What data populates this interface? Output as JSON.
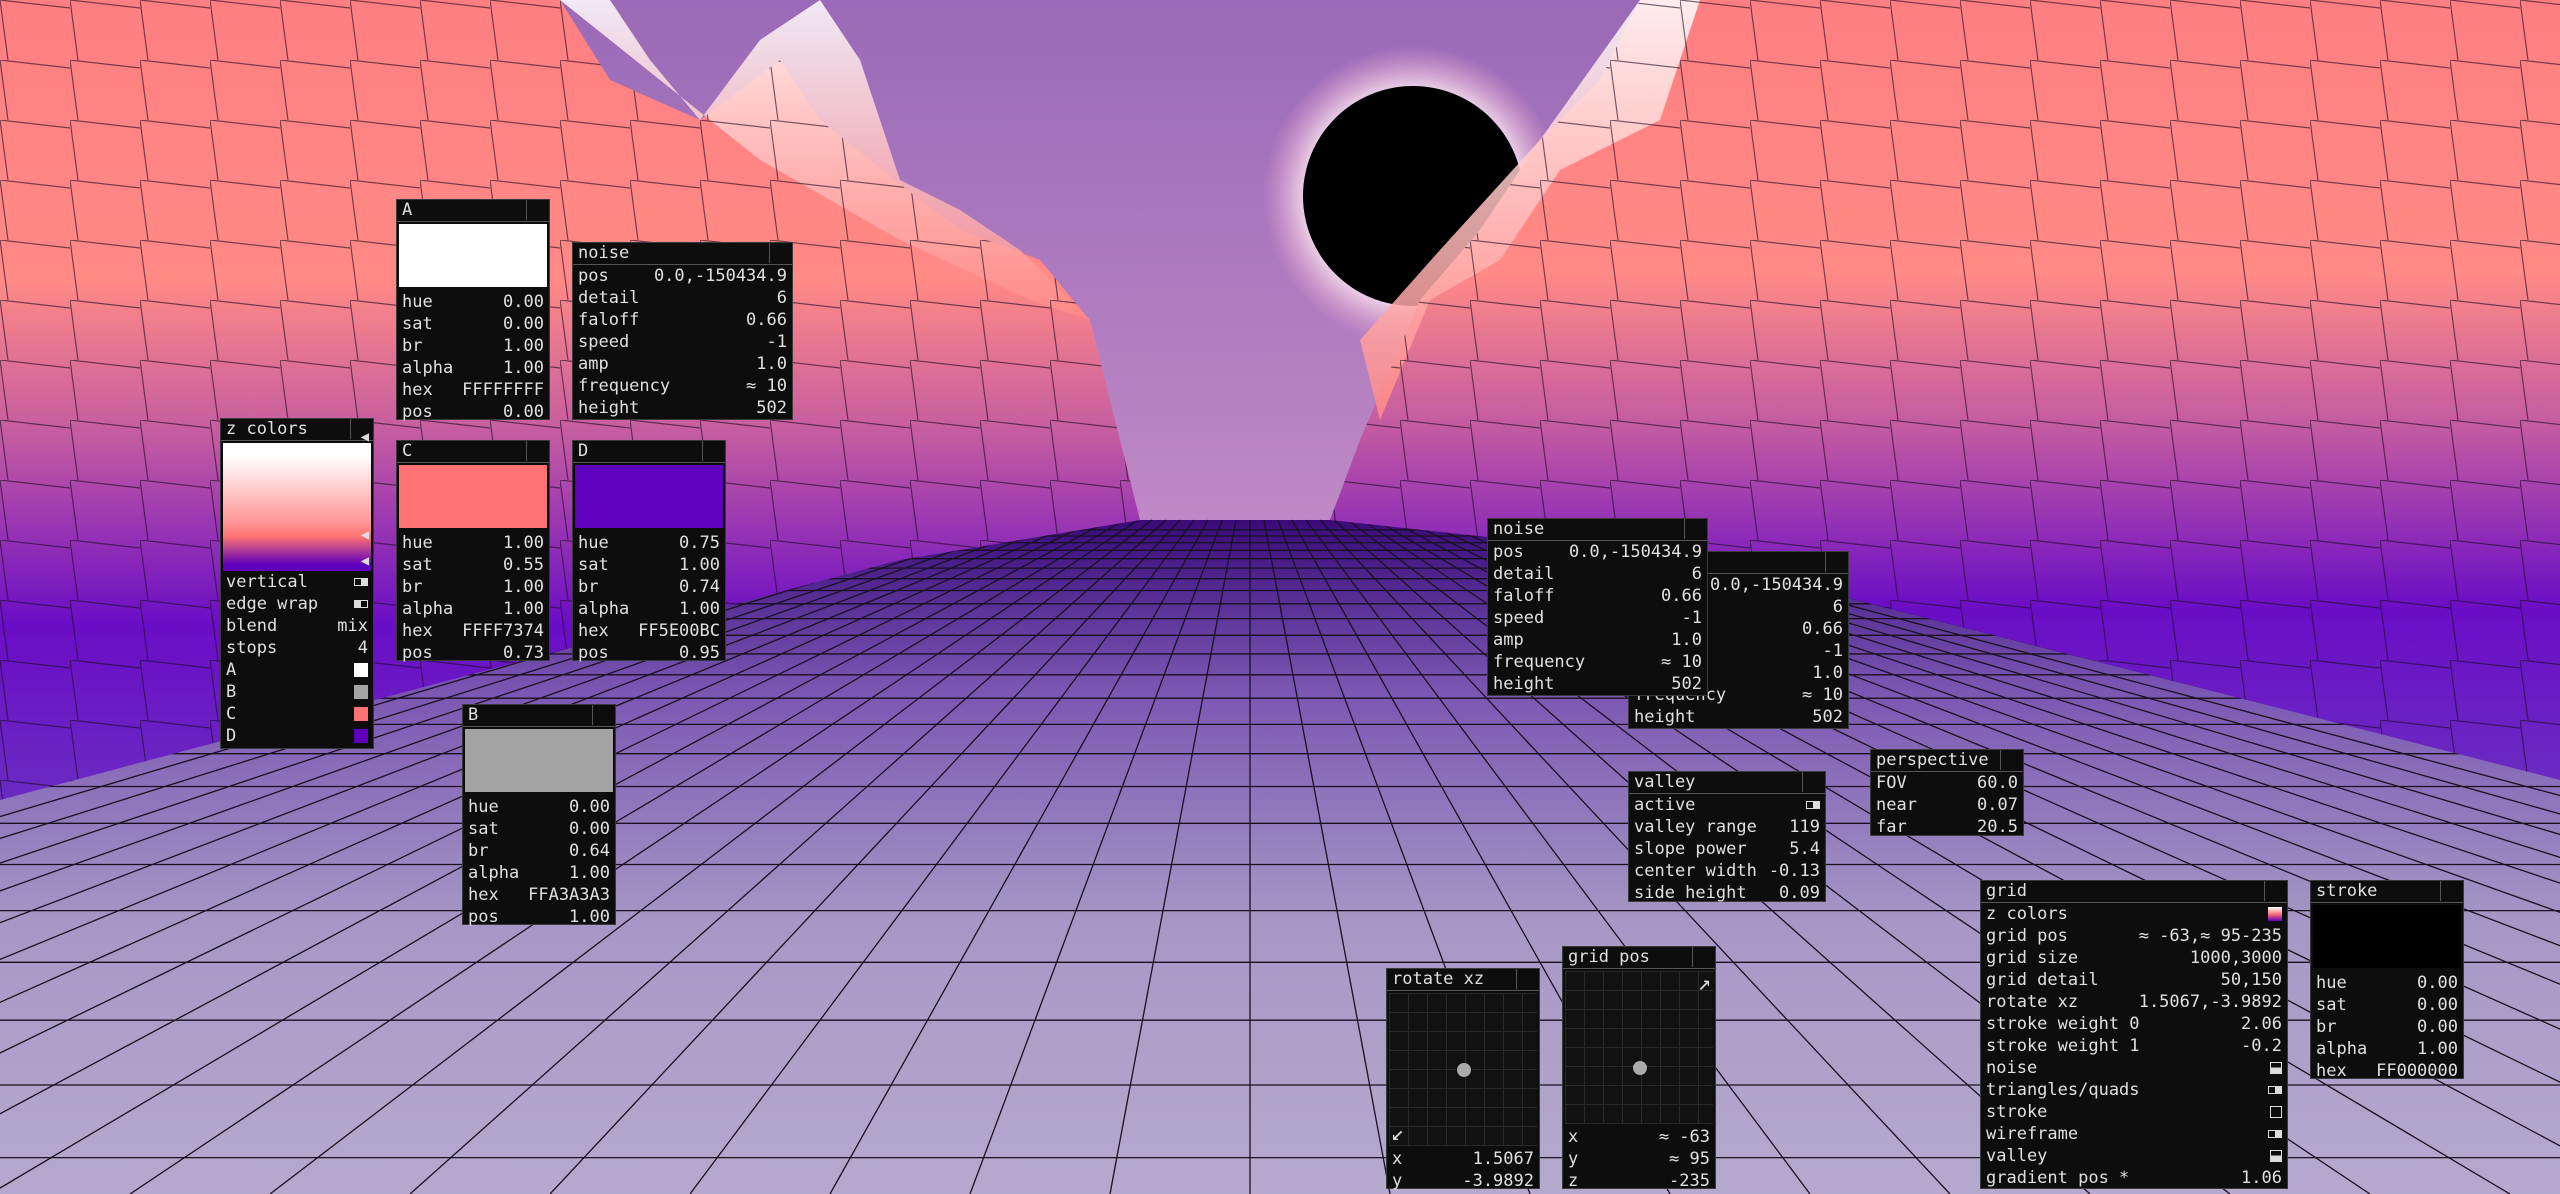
{
  "colors": {
    "A": "#FFFFFF",
    "B": "#A3A3A3",
    "C": "#FF7374",
    "D": "#5E00BC",
    "stroke": "#000000"
  },
  "panel_a": {
    "title": "A",
    "hue_label": "hue",
    "hue": "0.00",
    "sat_label": "sat",
    "sat": "0.00",
    "br_label": "br",
    "br": "1.00",
    "alpha_label": "alpha",
    "alpha": "1.00",
    "hex_label": "hex",
    "hex": "FFFFFFFF",
    "pos_label": "pos",
    "pos": "0.00"
  },
  "panel_b": {
    "title": "B",
    "hue_label": "hue",
    "hue": "0.00",
    "sat_label": "sat",
    "sat": "0.00",
    "br_label": "br",
    "br": "0.64",
    "alpha_label": "alpha",
    "alpha": "1.00",
    "hex_label": "hex",
    "hex": "FFA3A3A3",
    "pos_label": "pos",
    "pos": "1.00"
  },
  "panel_c": {
    "title": "C",
    "hue_label": "hue",
    "hue": "1.00",
    "sat_label": "sat",
    "sat": "0.55",
    "br_label": "br",
    "br": "1.00",
    "alpha_label": "alpha",
    "alpha": "1.00",
    "hex_label": "hex",
    "hex": "FFFF7374",
    "pos_label": "pos",
    "pos": "0.73"
  },
  "panel_d": {
    "title": "D",
    "hue_label": "hue",
    "hue": "0.75",
    "sat_label": "sat",
    "sat": "1.00",
    "br_label": "br",
    "br": "0.74",
    "alpha_label": "alpha",
    "alpha": "1.00",
    "hex_label": "hex",
    "hex": "FF5E00BC",
    "pos_label": "pos",
    "pos": "0.95"
  },
  "noise1": {
    "title": "noise",
    "rows": [
      {
        "k": "pos",
        "v": "0.0,-150434.9"
      },
      {
        "k": "detail",
        "v": "6"
      },
      {
        "k": "faloff",
        "v": "0.66"
      },
      {
        "k": "speed",
        "v": "-1"
      },
      {
        "k": "amp",
        "v": "1.0"
      },
      {
        "k": "frequency",
        "v": "≈ 10"
      },
      {
        "k": "height",
        "v": "502"
      }
    ]
  },
  "noise_back": {
    "values": [
      "0.0,-150434.9",
      "6",
      "0.66",
      "-1",
      "1.0",
      "≈ 10",
      "502"
    ],
    "frequency_label": "frequency",
    "height_label": "height"
  },
  "noise2": {
    "title": "noise",
    "rows": [
      {
        "k": "pos",
        "v": "0.0,-150434.9"
      },
      {
        "k": "detail",
        "v": "6"
      },
      {
        "k": "faloff",
        "v": "0.66"
      },
      {
        "k": "speed",
        "v": "-1"
      },
      {
        "k": "amp",
        "v": "1.0"
      },
      {
        "k": "frequency",
        "v": "≈ 10"
      },
      {
        "k": "height",
        "v": "502"
      }
    ]
  },
  "zcolors": {
    "title": "z colors",
    "vertical_label": "vertical",
    "edge_wrap_label": "edge wrap",
    "blend_label": "blend",
    "blend": "mix",
    "stops_label": "stops",
    "stops": "4",
    "a_label": "A",
    "b_label": "B",
    "c_label": "C",
    "d_label": "D"
  },
  "valley": {
    "title": "valley",
    "active_label": "active",
    "rows": [
      {
        "k": "valley range",
        "v": "119"
      },
      {
        "k": "slope power",
        "v": "5.4"
      },
      {
        "k": "center width",
        "v": "-0.13"
      },
      {
        "k": "side height",
        "v": "0.09"
      }
    ]
  },
  "perspective": {
    "title": "perspective",
    "rows": [
      {
        "k": "FOV",
        "v": "60.0"
      },
      {
        "k": "near",
        "v": "0.07"
      },
      {
        "k": "far",
        "v": "20.5"
      }
    ]
  },
  "rotate_xz": {
    "title": "rotate xz",
    "x_label": "x",
    "x": "1.5067",
    "y_label": "y",
    "y": "-3.9892"
  },
  "grid_pos": {
    "title": "grid pos",
    "x_label": "x",
    "x": "≈ -63",
    "y_label": "y",
    "y": "≈ 95",
    "z_label": "z",
    "z": "-235"
  },
  "grid": {
    "title": "grid",
    "z_colors_label": "z colors",
    "rows": [
      {
        "k": "grid pos",
        "v": "≈ -63,≈ 95-235"
      },
      {
        "k": "grid size",
        "v": "1000,3000"
      },
      {
        "k": "grid detail",
        "v": "50,150"
      },
      {
        "k": "rotate xz",
        "v": "1.5067,-3.9892"
      },
      {
        "k": "stroke weight 0",
        "v": "2.06"
      },
      {
        "k": "stroke weight 1",
        "v": "-0.2"
      }
    ],
    "noise_label": "noise",
    "triangles_label": "triangles/quads",
    "stroke_label": "stroke",
    "wireframe_label": "wireframe",
    "valley_label": "valley",
    "gradient_pos_label": "gradient pos *",
    "gradient_pos": "1.06"
  },
  "stroke": {
    "title": "stroke",
    "hue_label": "hue",
    "hue": "0.00",
    "sat_label": "sat",
    "sat": "0.00",
    "br_label": "br",
    "br": "0.00",
    "alpha_label": "alpha",
    "alpha": "1.00",
    "hex_label": "hex",
    "hex": "FF000000"
  }
}
